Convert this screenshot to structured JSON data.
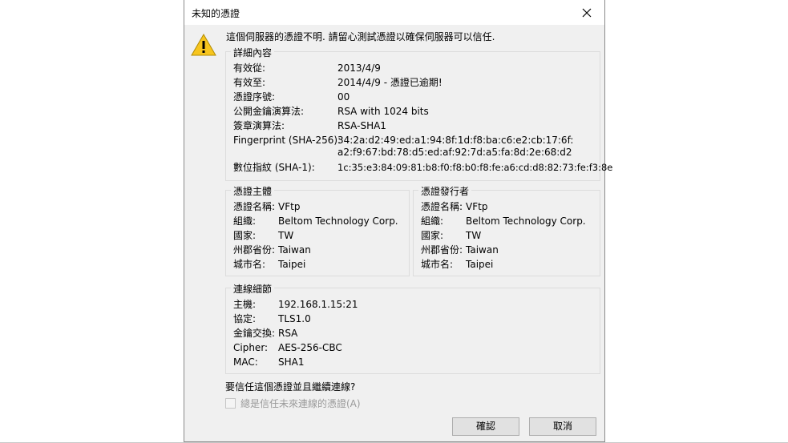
{
  "dialog": {
    "title": "未知的憑證",
    "message": "這個伺服器的憑證不明. 請留心測試憑證以確保伺服器可以信任.",
    "icons": {
      "close": "close-icon",
      "warning": "warning-icon"
    }
  },
  "details": {
    "title": "詳細內容",
    "valid_from_label": "有效從:",
    "valid_from": "2013/4/9",
    "valid_to_label": "有效至:",
    "valid_to": "2014/4/9 - 憑證已逾期!",
    "serial_label": "憑證序號:",
    "serial": "00",
    "pubkey_label": "公開金鑰演算法:",
    "pubkey": "RSA with 1024 bits",
    "sigalg_label": "簽章演算法:",
    "sigalg": "RSA-SHA1",
    "sha256_label": "Fingerprint (SHA-256):",
    "sha256_line1": "34:2a:d2:49:ed:a1:94:8f:1d:f8:ba:c6:e2:cb:17:6f:",
    "sha256_line2": "a2:f9:67:bd:78:d5:ed:af:92:7d:a5:fa:8d:2e:68:d2",
    "sha1_label": "數位指紋 (SHA-1):",
    "sha1": "1c:35:e3:84:09:81:b8:f0:f8:b0:f8:fe:a6:cd:d8:82:73:fe:f3:8e"
  },
  "subject": {
    "title": "憑證主體",
    "name_label": "憑證名稱:",
    "name": "VFtp",
    "org_label": "組織:",
    "org": "Beltom Technology Corp.",
    "country_label": "國家:",
    "country": "TW",
    "state_label": "州郡省份:",
    "state": "Taiwan",
    "city_label": "城市名:",
    "city": "Taipei"
  },
  "issuer": {
    "title": "憑證發行者",
    "name_label": "憑證名稱:",
    "name": "VFtp",
    "org_label": "組織:",
    "org": "Beltom Technology Corp.",
    "country_label": "國家:",
    "country": "TW",
    "state_label": "州郡省份:",
    "state": "Taiwan",
    "city_label": "城市名:",
    "city": "Taipei"
  },
  "connection": {
    "title": "連線細節",
    "host_label": "主機:",
    "host": "192.168.1.15:21",
    "protocol_label": "協定:",
    "protocol": "TLS1.0",
    "kex_label": "金鑰交換:",
    "kex": "RSA",
    "cipher_label": "Cipher:",
    "cipher": "AES-256-CBC",
    "mac_label": "MAC:",
    "mac": "SHA1"
  },
  "prompt": {
    "question": "要信任這個憑證並且繼續連線?",
    "always_trust_label": "總是信任未來連線的憑證(A)",
    "always_trust_checked": false
  },
  "buttons": {
    "ok": "確認",
    "cancel": "取消"
  }
}
